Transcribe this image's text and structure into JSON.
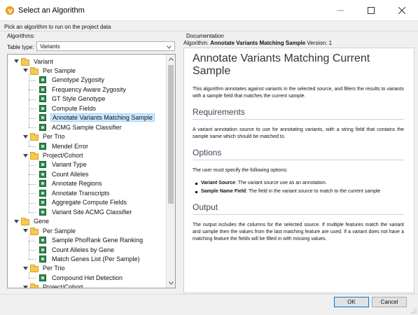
{
  "window": {
    "title": "Select an Algorithm",
    "subtitle": "Pick an algorithm to run on the project data"
  },
  "left": {
    "label": "Algorithms:",
    "table_type_label": "Table type:",
    "table_type_value": "Variants"
  },
  "tree": [
    {
      "label": "Variant",
      "type": "folder",
      "expanded": true
    },
    {
      "label": "Per Sample",
      "type": "folder",
      "expanded": true
    },
    {
      "label": "Genotype Zygosity",
      "type": "algorithm"
    },
    {
      "label": "Frequency Aware Zygosity",
      "type": "algorithm"
    },
    {
      "label": "GT Style Genotype",
      "type": "algorithm"
    },
    {
      "label": "Compute Fields",
      "type": "algorithm"
    },
    {
      "label": "Annotate Variants Matching Sample",
      "type": "algorithm",
      "selected": true
    },
    {
      "label": "ACMG Sample Classifier",
      "type": "algorithm"
    },
    {
      "label": "Per Trio",
      "type": "folder",
      "expanded": true
    },
    {
      "label": "Mendel Error",
      "type": "algorithm"
    },
    {
      "label": "Project/Cohort",
      "type": "folder",
      "expanded": true
    },
    {
      "label": "Variant Type",
      "type": "algorithm"
    },
    {
      "label": "Count Alleles",
      "type": "algorithm"
    },
    {
      "label": "Annotate Regions",
      "type": "algorithm"
    },
    {
      "label": "Annotate Transcripts",
      "type": "algorithm"
    },
    {
      "label": "Aggregate Compute Fields",
      "type": "algorithm"
    },
    {
      "label": "Variant Site ACMG Classifier",
      "type": "algorithm"
    },
    {
      "label": "Gene",
      "type": "folder",
      "expanded": true
    },
    {
      "label": "Per Sample",
      "type": "folder",
      "expanded": true
    },
    {
      "label": "Sample PhoRank Gene Ranking",
      "type": "algorithm"
    },
    {
      "label": "Count Alleles by Gene",
      "type": "algorithm"
    },
    {
      "label": "Match Genes List (Per Sample)",
      "type": "algorithm"
    },
    {
      "label": "Per Trio",
      "type": "folder",
      "expanded": true
    },
    {
      "label": "Compound Het Detection",
      "type": "algorithm"
    },
    {
      "label": "Project/Cohort",
      "type": "folder",
      "expanded": true
    }
  ],
  "doc": {
    "label": "Documentation",
    "algorithm_prefix": "Algorithm:",
    "algorithm_name": "Annotate Variants Matching Sample",
    "version": "Version: 1",
    "title": "Annotate Variants Matching Current Sample",
    "intro": "This algorithm annotates against variants in the selected source, and filters the results to variants with a sample field that matches the current sample.",
    "requirements_heading": "Requirements",
    "requirements_text": "A variant annotation source to use for annotating variants, with a string field that contains the sample name which should be matched to.",
    "options_heading": "Options",
    "options_text": "The user must specify the following options:",
    "options": [
      {
        "name": "Variant Source",
        "desc": ": The variant source use as an annotation."
      },
      {
        "name": "Sample Name Field",
        "desc": ": The field in the variant source to match to the current sample"
      }
    ],
    "output_heading": "Output",
    "output_text": "The output includes the columns for the selected source. If multiple features match the variant and sample then the values from the last matching feature are used. If a variant does not have a matching feature the fields will be filled in with missing values."
  },
  "buttons": {
    "ok": "OK",
    "cancel": "Cancel"
  },
  "colors": {
    "selection": "#cce8ff",
    "folder": "#f6c94f",
    "algorithm_icon": "#2e8a4f",
    "ok_border": "#0078d7"
  }
}
